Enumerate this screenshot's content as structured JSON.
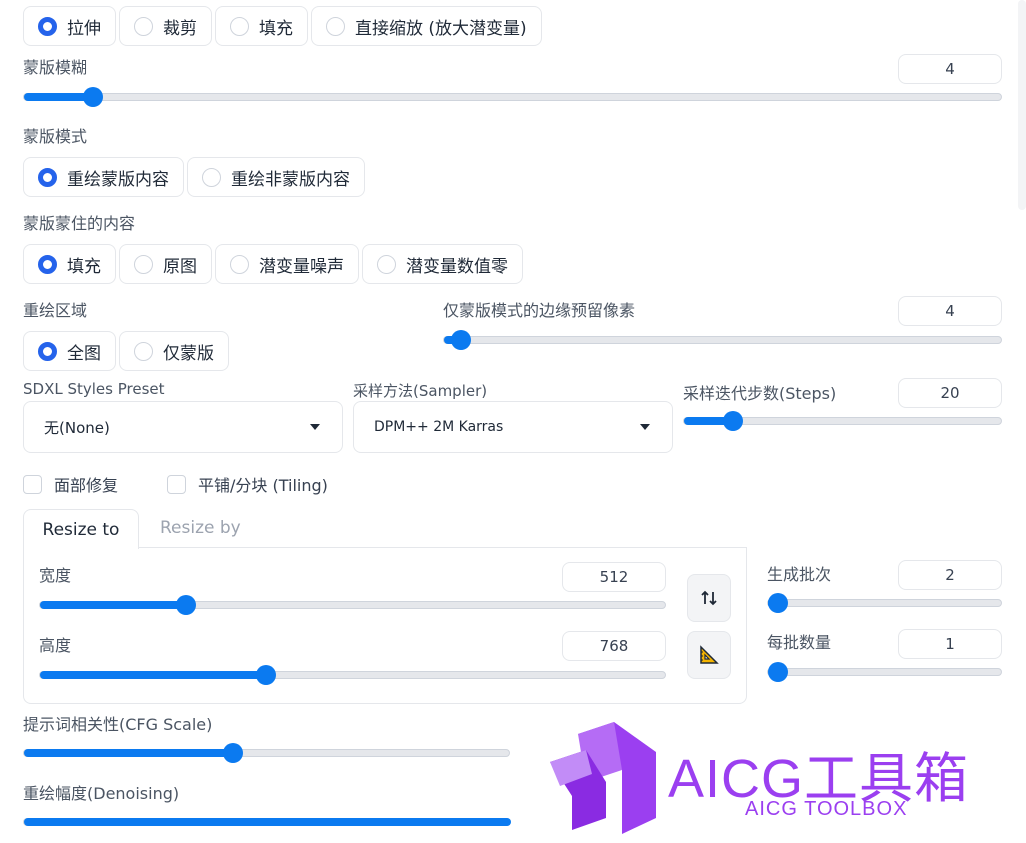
{
  "resize_mode": {
    "options": [
      "拉伸",
      "裁剪",
      "填充",
      "直接缩放 (放大潜变量)"
    ],
    "selected": 0
  },
  "mask_blur": {
    "label": "蒙版模糊",
    "value": "4",
    "fraction": 0.07
  },
  "mask_mode": {
    "label": "蒙版模式",
    "options": [
      "重绘蒙版内容",
      "重绘非蒙版内容"
    ],
    "selected": 0
  },
  "masked_content": {
    "label": "蒙版蒙住的内容",
    "options": [
      "填充",
      "原图",
      "潜变量噪声",
      "潜变量数值零"
    ],
    "selected": 0
  },
  "inpaint_area": {
    "label": "重绘区域",
    "options": [
      "全图",
      "仅蒙版"
    ],
    "selected": 0
  },
  "only_masked_padding": {
    "label": "仅蒙版模式的边缘预留像素",
    "value": "4",
    "fraction": 0.03
  },
  "styles_preset": {
    "label": "SDXL Styles Preset",
    "value": "无(None)"
  },
  "sampler": {
    "label": "采样方法(Sampler)",
    "value": "DPM++ 2M Karras"
  },
  "steps": {
    "label": "采样迭代步数(Steps)",
    "value": "20",
    "fraction": 0.155
  },
  "checkboxes": [
    {
      "label": "面部修复",
      "checked": false
    },
    {
      "label": "平铺/分块 (Tiling)",
      "checked": false
    }
  ],
  "resize_tabs": [
    "Resize to",
    "Resize by"
  ],
  "width": {
    "label": "宽度",
    "value": "512",
    "fraction": 0.233
  },
  "height": {
    "label": "高度",
    "value": "768",
    "fraction": 0.36
  },
  "batch_count": {
    "label": "生成批次",
    "value": "2",
    "fraction": 0.02
  },
  "batch_size": {
    "label": "每批数量",
    "value": "1",
    "fraction": 0.0
  },
  "cfg_scale": {
    "label": "提示词相关性(CFG Scale)",
    "fraction": 0.43
  },
  "denoising": {
    "label": "重绘幅度(Denoising)",
    "fraction": 1.0
  },
  "watermark": {
    "title": "AICG工具箱",
    "subtitle": "AICG TOOLBOX"
  },
  "colors": {
    "accent": "#0b7af0",
    "radio": "#2563eb",
    "logo": "#9b3ff0"
  },
  "icons": {
    "swap": "swap-arrows-icon",
    "ratio": "triangle-ruler-icon",
    "dropdown": "chevron-down-icon"
  }
}
